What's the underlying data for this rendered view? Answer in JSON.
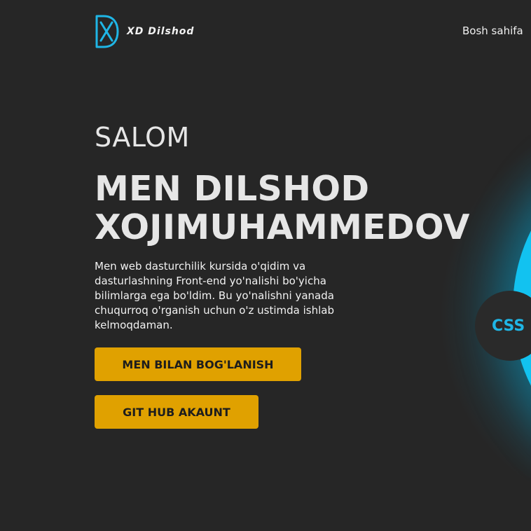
{
  "header": {
    "logo_text": "XD Dilshod",
    "nav_home": "Bosh sahifa"
  },
  "hero": {
    "greeting": "SALOM",
    "name_line1": "MEN DILSHOD",
    "name_line2": "XOJIMUHAMMEDOV",
    "about": "Men web dasturchilik kursida o'qidim va dasturlashning Front-end yo'nalishi bo'yicha bilimlarga ega bo'ldim. Bu yo'nalishni yanada chuqurroq o'rganish uchun o'z ustimda ishlab kelmoqdaman.",
    "contact_button": "MEN BILAN BOG'LANISH",
    "github_button": "GIT HUB AKAUNT"
  },
  "skills": {
    "css_badge": "CSS"
  },
  "colors": {
    "background": "#262626",
    "accent_button": "#e0a100",
    "accent_cyan": "#12c2f0",
    "logo_icon": "#1fb6e6"
  },
  "icons": {
    "logo": "xd-logo-icon"
  }
}
